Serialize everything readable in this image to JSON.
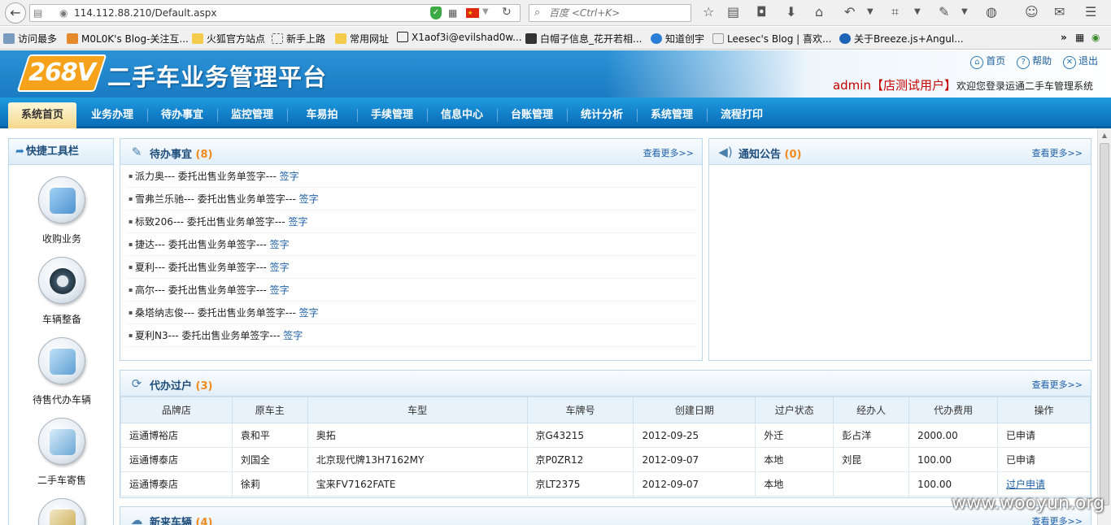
{
  "browser": {
    "url": "114.112.88.210/Default.aspx",
    "search_placeholder": "百度 <Ctrl+K>",
    "bookmarks": [
      "访问最多",
      "M0L0K's Blog-关注互...",
      "火狐官方站点",
      "新手上路",
      "常用网址",
      "X1aof3i@evilshad0w...",
      "白帽子信息_花开若相...",
      "知道创宇",
      "Leesec's Blog | 喜欢...",
      "关于Breeze.js+Angul..."
    ],
    "overflow": "»"
  },
  "header": {
    "logo": "268V",
    "title": "二手车业务管理平台",
    "links": {
      "home": "首页",
      "help": "帮助",
      "logout": "退出"
    },
    "user": "admin【店测试用户】",
    "welcome": "欢迎您登录运通二手车管理系统"
  },
  "nav": [
    "系统首页",
    "业务办理",
    "待办事宜",
    "监控管理",
    "车易拍",
    "手续管理",
    "信息中心",
    "台账管理",
    "统计分析",
    "系统管理",
    "流程打印"
  ],
  "quick": {
    "title": "快捷工具栏",
    "items": [
      "收购业务",
      "车辆整备",
      "待售代办车辆",
      "二手车寄售"
    ]
  },
  "todo": {
    "title": "待办事宜",
    "count": "(8)",
    "more": "查看更多>>",
    "items": [
      {
        "text": "派力奥--- 委托出售业务单签字---",
        "link": "签字"
      },
      {
        "text": "雪弗兰乐驰--- 委托出售业务单签字---",
        "link": "签字"
      },
      {
        "text": "标致206--- 委托出售业务单签字---",
        "link": "签字"
      },
      {
        "text": "捷达--- 委托出售业务单签字---",
        "link": "签字"
      },
      {
        "text": "夏利--- 委托出售业务单签字---",
        "link": "签字"
      },
      {
        "text": "高尔--- 委托出售业务单签字---",
        "link": "签字"
      },
      {
        "text": "桑塔纳志俊--- 委托出售业务单签字---",
        "link": "签字"
      },
      {
        "text": "夏利N3--- 委托出售业务单签字---",
        "link": "签字"
      }
    ]
  },
  "notice": {
    "title": "通知公告",
    "count": "(0)",
    "more": "查看更多>>"
  },
  "transfer": {
    "title": "代办过户",
    "count": "(3)",
    "more": "查看更多>>",
    "columns": [
      "品牌店",
      "原车主",
      "车型",
      "车牌号",
      "创建日期",
      "过户状态",
      "经办人",
      "代办费用",
      "操作"
    ],
    "rows": [
      [
        "运通博裕店",
        "袁和平",
        "奥拓",
        "京G43215",
        "2012-09-25",
        "外迁",
        "彭占洋",
        "2000.00",
        "已申请"
      ],
      [
        "运通博泰店",
        "刘国全",
        "北京现代牌13H7162MY",
        "京P0ZR12",
        "2012-09-07",
        "本地",
        "刘昆",
        "100.00",
        "已申请"
      ],
      [
        "运通博泰店",
        "徐莉",
        "宝来FV7162FATE",
        "京LT2375",
        "2012-09-07",
        "本地",
        "",
        "100.00",
        "过户申请"
      ]
    ]
  },
  "newcars": {
    "title": "新来车辆",
    "count": "(4)",
    "more": "查看更多>>"
  },
  "watermark": "www.wooyun.org"
}
